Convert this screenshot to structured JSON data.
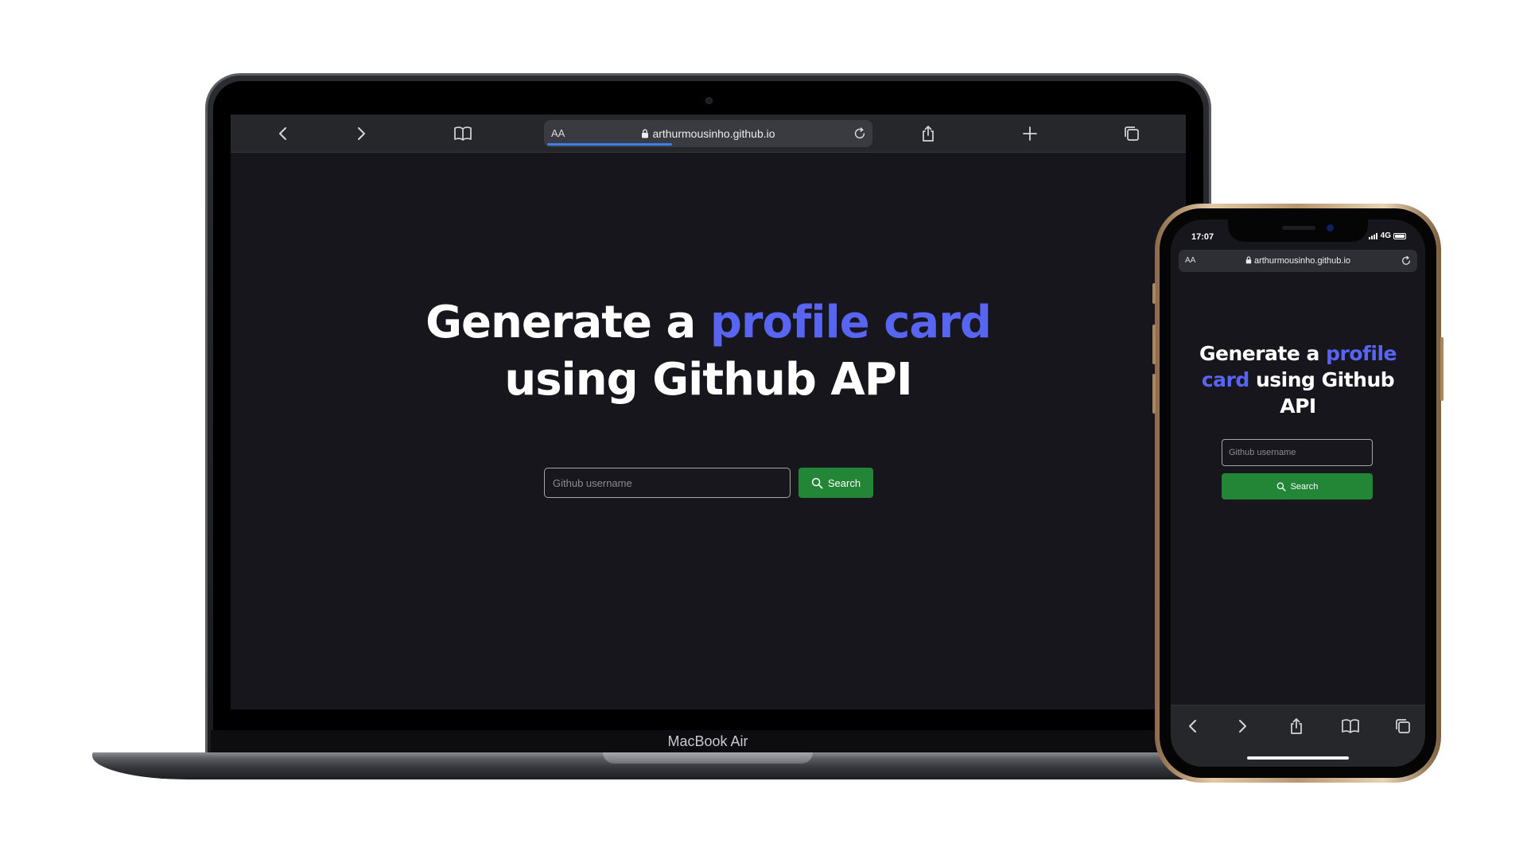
{
  "laptop": {
    "brand": "MacBook Air",
    "browser": {
      "text_size_label": "AA",
      "url": "arthurmousinho.github.io",
      "load_progress": 0.38
    }
  },
  "phone": {
    "status": {
      "time": "17:07",
      "network": "4G"
    },
    "browser": {
      "text_size_label": "AA",
      "url": "arthurmousinho.github.io"
    }
  },
  "page": {
    "title_prefix": "Generate a ",
    "title_accent": "profile card",
    "title_suffix": " using Github API",
    "search_placeholder": "Github username",
    "search_button_label": "Search"
  },
  "colors": {
    "accent": "#5865f2",
    "button_green": "#238636",
    "page_background": "#17161d"
  },
  "icons": {
    "toolbar": [
      "chevron-left-icon",
      "chevron-right-icon",
      "bookmarks-icon",
      "lock-icon",
      "reload-icon",
      "share-icon",
      "plus-icon",
      "tabs-icon"
    ],
    "search": "search-icon"
  }
}
